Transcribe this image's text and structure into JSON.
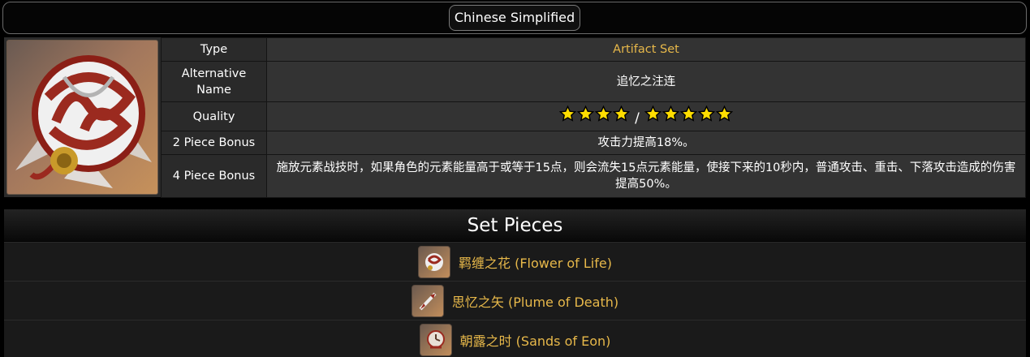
{
  "language_button": "Chinese Simplified",
  "info": {
    "image": "artifact-set-icon",
    "rows": [
      {
        "key": "Type",
        "value": "Artifact Set"
      },
      {
        "key": "Alternative Name",
        "value": "追忆之注连"
      },
      {
        "key": "Quality",
        "value": "4 stars / 5 stars"
      },
      {
        "key": "2 Piece Bonus",
        "value": "攻击力提高18%。"
      },
      {
        "key": "4 Piece Bonus",
        "value": "施放元素战技时，如果角色的元素能量高于或等于15点，则会流失15点元素能量，使接下来的10秒内，普通攻击、重击、下落攻击造成的伤害提高50%。"
      }
    ],
    "quality_stars": {
      "low": 4,
      "high": 5,
      "star_color": "#ffdd00",
      "separator": "/"
    }
  },
  "pieces": {
    "heading": "Set Pieces",
    "items": [
      {
        "name": "羁缠之花 (Flower of Life)",
        "icon": "flower-icon"
      },
      {
        "name": "思忆之矢 (Plume of Death)",
        "icon": "plume-icon"
      },
      {
        "name": "朝露之时 (Sands of Eon)",
        "icon": "sands-icon"
      }
    ]
  },
  "colors": {
    "accent": "#e7b84a",
    "background": "#000000"
  }
}
